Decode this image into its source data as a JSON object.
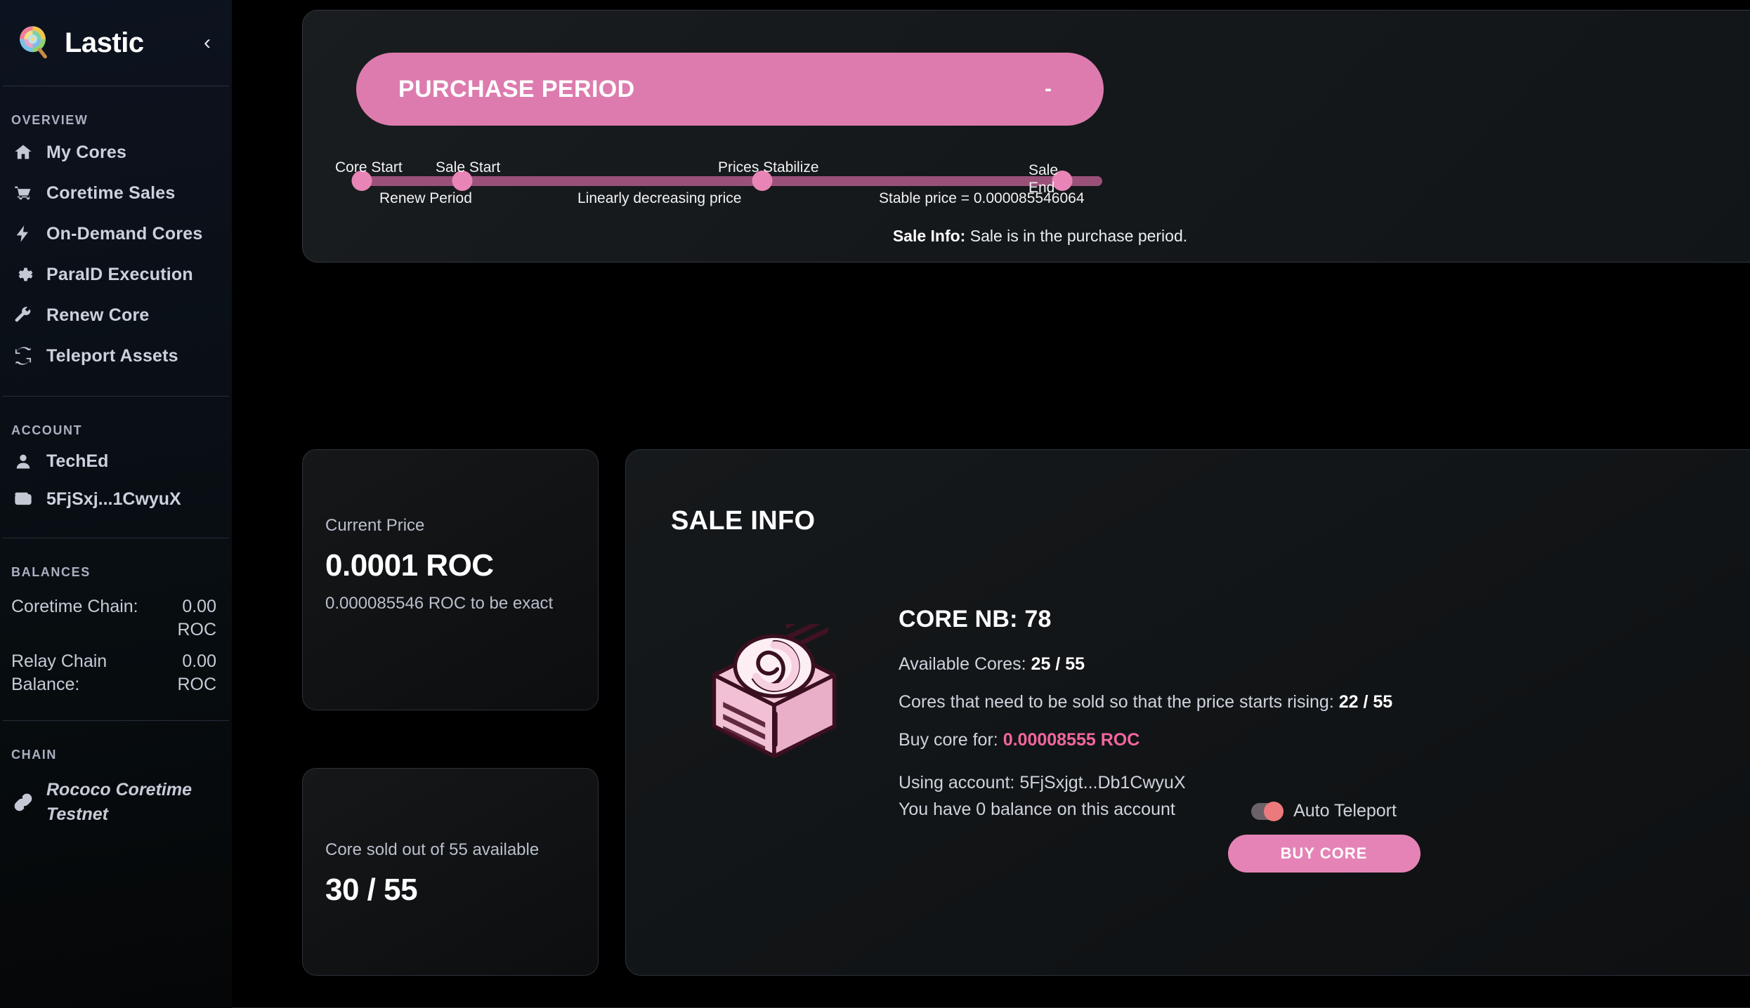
{
  "sidebar": {
    "brand": {
      "name": "Lastic",
      "logo_icon": "lollipop-icon",
      "collapse_icon": "chevron-left-icon"
    },
    "sections": [
      {
        "title": "OVERVIEW",
        "items": [
          {
            "label": "My Cores",
            "icon": "home-icon"
          },
          {
            "label": "Coretime Sales",
            "icon": "shopping-cart-icon"
          },
          {
            "label": "On-Demand Cores",
            "icon": "lightning-bolt-icon"
          },
          {
            "label": "ParaID Execution",
            "icon": "gear-icon"
          },
          {
            "label": "Renew Core",
            "icon": "wrench-icon"
          },
          {
            "label": "Teleport Assets",
            "icon": "refresh-icon"
          }
        ]
      }
    ],
    "account": {
      "title": "ACCOUNT",
      "user": {
        "label": "TechEd",
        "icon": "person-icon"
      },
      "wallet": {
        "label": "5FjSxj...1CwyuX",
        "icon": "wallet-icon"
      }
    },
    "balances": {
      "title": "BALANCES",
      "rows": [
        {
          "key": "Coretime Chain:",
          "value": "0.00 ROC"
        },
        {
          "key": "Relay Chain Balance:",
          "value": "0.00 ROC"
        }
      ]
    },
    "chain": {
      "title": "CHAIN",
      "name": "Rococo Coretime Testnet",
      "icon": "link-icon"
    }
  },
  "banner": {
    "title": "PURCHASE PERIOD",
    "countdown": "-",
    "color": "#dd7bae"
  },
  "timeline": {
    "markers": [
      {
        "label": "Core Start",
        "pos": 0
      },
      {
        "label": "Sale Start",
        "pos": 13.5
      },
      {
        "label": "Prices Stabilize",
        "pos": 54
      },
      {
        "label": "Sale End",
        "pos": 100
      }
    ],
    "segments": [
      {
        "label": "Renew Period",
        "pos": 6.5
      },
      {
        "label": "Linearly decreasing price",
        "pos": 33.5
      },
      {
        "label": "Stable price = 0.000085546064",
        "pos": 82
      }
    ],
    "track_color": "#9a5179",
    "dot_color": "#e884b6"
  },
  "sale_note": {
    "label": "Sale Info:",
    "text": "Sale is in the purchase period."
  },
  "cards": {
    "current_price": {
      "label": "Current Price",
      "value": "0.0001 ROC",
      "sub": "0.000085546 ROC to be exact"
    },
    "cores_sold": {
      "label": "Core sold out of 55 available",
      "value": "30 / 55"
    }
  },
  "sale_info": {
    "title": "SALE INFO",
    "core_nb_label": "CORE NB:",
    "core_nb_value": "78",
    "available_cores_label": "Available Cores:",
    "available_cores_value": "25 / 55",
    "need_sold_label": "Cores that need to be sold so that the price starts rising:",
    "need_sold_value": "22 / 55",
    "buy_core_for_label": "Buy core for:",
    "buy_core_for_value": "0.00008555 ROC",
    "buy_core_for_color": "#f2669f",
    "using_account": "Using account: 5FjSxjgt...Db1CwyuX",
    "balance_note": "You have 0 balance on this account",
    "auto_teleport_label": "Auto Teleport",
    "auto_teleport_on": true,
    "buy_button_label": "BUY CORE",
    "core_art_icon": "coretime-cake-cube-icon"
  }
}
